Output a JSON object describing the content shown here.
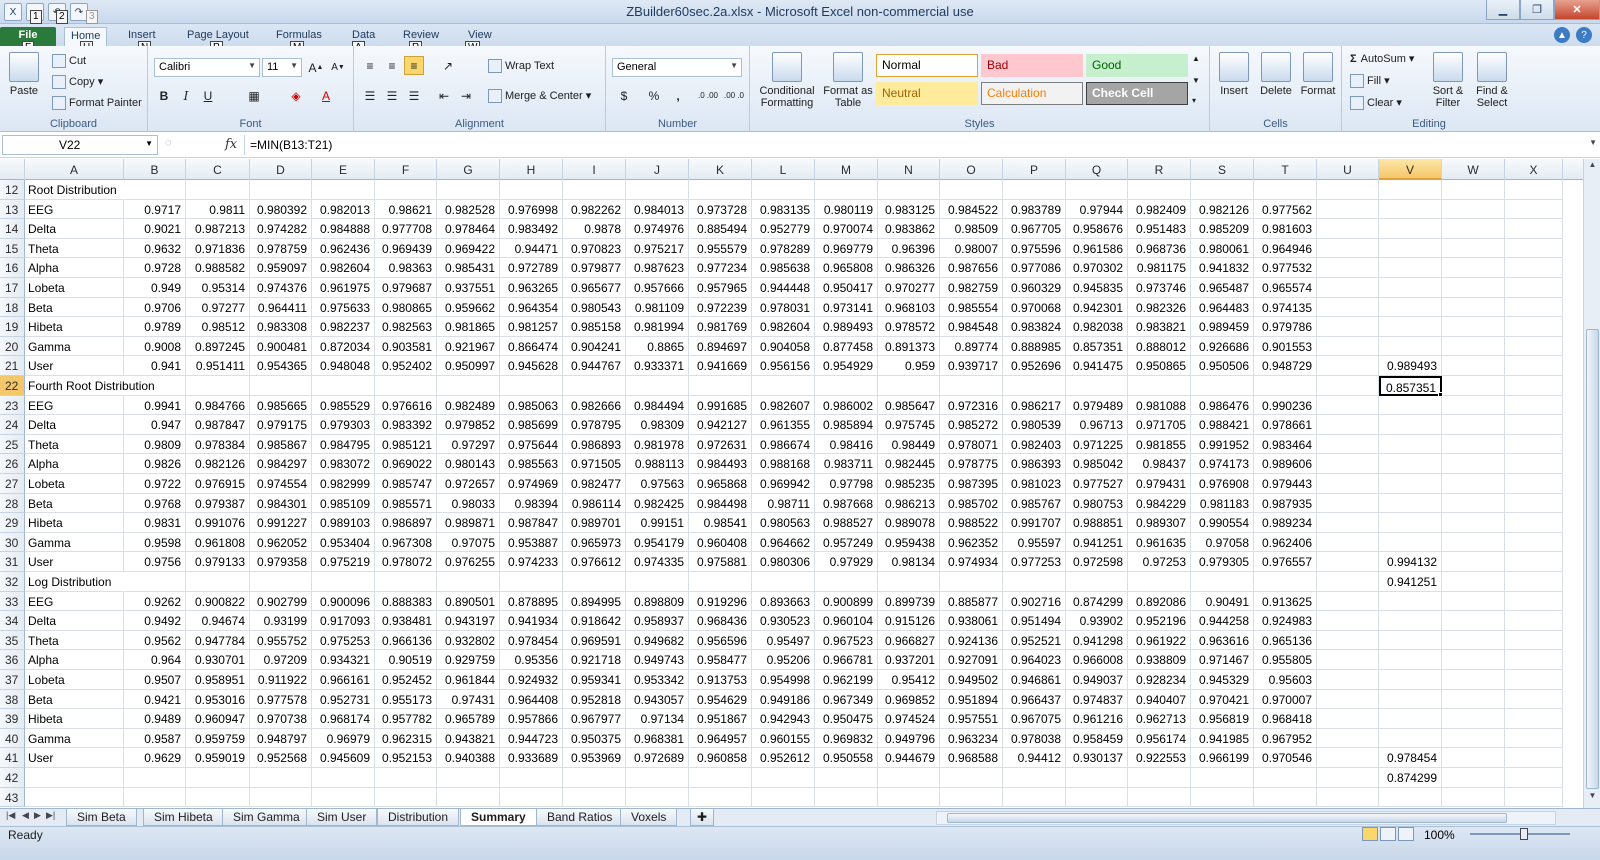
{
  "window": {
    "title": "ZBuilder60sec.2a.xlsx  -  Microsoft Excel non-commercial use"
  },
  "qat": {
    "keytips": [
      "1",
      "2",
      "3"
    ]
  },
  "ribbon_tabs": [
    {
      "label": "File",
      "keytip": "F"
    },
    {
      "label": "Home",
      "keytip": "H"
    },
    {
      "label": "Insert",
      "keytip": "N"
    },
    {
      "label": "Page Layout",
      "keytip": "P"
    },
    {
      "label": "Formulas",
      "keytip": "M"
    },
    {
      "label": "Data",
      "keytip": "A"
    },
    {
      "label": "Review",
      "keytip": "R"
    },
    {
      "label": "View",
      "keytip": "W"
    }
  ],
  "clipboard": {
    "paste": "Paste",
    "cut": "Cut",
    "copy": "Copy",
    "format_painter": "Format Painter",
    "label": "Clipboard"
  },
  "font": {
    "name": "Calibri",
    "size": "11",
    "label": "Font",
    "bold": "B",
    "italic": "I",
    "underline": "U"
  },
  "alignment": {
    "wrap": "Wrap Text",
    "merge": "Merge & Center",
    "label": "Alignment"
  },
  "number": {
    "format": "General",
    "label": "Number",
    "currency": "$",
    "percent": "%",
    "comma": ",",
    "inc": ".0 .00",
    "dec": ".00 .0"
  },
  "styles": {
    "conditional": "Conditional Formatting",
    "format_table": "Format as Table",
    "label": "Styles",
    "cells": [
      {
        "name": "Normal",
        "bg": "#ffffff",
        "fg": "#000000",
        "border": "#e2a233"
      },
      {
        "name": "Bad",
        "bg": "#ffc7ce",
        "fg": "#9c0006",
        "border": "#ffc7ce"
      },
      {
        "name": "Good",
        "bg": "#c6efce",
        "fg": "#006100",
        "border": "#c6efce"
      },
      {
        "name": "Neutral",
        "bg": "#ffeb9c",
        "fg": "#9c6500",
        "border": "#ffeb9c"
      },
      {
        "name": "Calculation",
        "bg": "#f2f2f2",
        "fg": "#fa7d00",
        "border": "#7f7f7f"
      },
      {
        "name": "Check Cell",
        "bg": "#a5a5a5",
        "fg": "#ffffff",
        "border": "#3f3f3f"
      }
    ]
  },
  "cells_group": {
    "insert": "Insert",
    "delete": "Delete",
    "format": "Format",
    "label": "Cells"
  },
  "editing": {
    "autosum": "AutoSum",
    "fill": "Fill",
    "clear": "Clear",
    "sort": "Sort & Filter",
    "find": "Find & Select",
    "label": "Editing"
  },
  "formula_bar": {
    "name_box": "V22",
    "fx": "fx",
    "formula": "=MIN(B13:T21)"
  },
  "columns": [
    "A",
    "B",
    "C",
    "D",
    "E",
    "F",
    "G",
    "H",
    "I",
    "J",
    "K",
    "L",
    "M",
    "N",
    "O",
    "P",
    "Q",
    "R",
    "S",
    "T",
    "U",
    "V",
    "W",
    "X"
  ],
  "active_column": "V",
  "active_row": 22,
  "rows": [
    {
      "n": 12,
      "a": "Root Distribution",
      "v": []
    },
    {
      "n": 13,
      "a": "EEG",
      "v": [
        "0.9717",
        "0.9811",
        "0.980392",
        "0.982013",
        "0.98621",
        "0.982528",
        "0.976998",
        "0.982262",
        "0.984013",
        "0.973728",
        "0.983135",
        "0.980119",
        "0.983125",
        "0.984522",
        "0.983789",
        "0.97944",
        "0.982409",
        "0.982126",
        "0.977562"
      ]
    },
    {
      "n": 14,
      "a": "Delta",
      "v": [
        "0.9021",
        "0.987213",
        "0.974282",
        "0.984888",
        "0.977708",
        "0.978464",
        "0.983492",
        "0.9878",
        "0.974976",
        "0.885494",
        "0.952779",
        "0.970074",
        "0.983862",
        "0.98509",
        "0.967705",
        "0.958676",
        "0.951483",
        "0.985209",
        "0.981603"
      ]
    },
    {
      "n": 15,
      "a": "Theta",
      "v": [
        "0.9632",
        "0.971836",
        "0.978759",
        "0.962436",
        "0.969439",
        "0.969422",
        "0.94471",
        "0.970823",
        "0.975217",
        "0.955579",
        "0.978289",
        "0.969779",
        "0.96396",
        "0.98007",
        "0.975596",
        "0.961586",
        "0.968736",
        "0.980061",
        "0.964946"
      ]
    },
    {
      "n": 16,
      "a": "Alpha",
      "v": [
        "0.9728",
        "0.988582",
        "0.959097",
        "0.982604",
        "0.98363",
        "0.985431",
        "0.972789",
        "0.979877",
        "0.987623",
        "0.977234",
        "0.985638",
        "0.965808",
        "0.986326",
        "0.987656",
        "0.977086",
        "0.970302",
        "0.981175",
        "0.941832",
        "0.977532"
      ]
    },
    {
      "n": 17,
      "a": "Lobeta",
      "v": [
        "0.949",
        "0.95314",
        "0.974376",
        "0.961975",
        "0.979687",
        "0.937551",
        "0.963265",
        "0.965677",
        "0.957666",
        "0.957965",
        "0.944448",
        "0.950417",
        "0.970277",
        "0.982759",
        "0.960329",
        "0.945835",
        "0.973746",
        "0.965487",
        "0.965574"
      ]
    },
    {
      "n": 18,
      "a": "Beta",
      "v": [
        "0.9706",
        "0.97277",
        "0.964411",
        "0.975633",
        "0.980865",
        "0.959662",
        "0.964354",
        "0.980543",
        "0.981109",
        "0.972239",
        "0.978031",
        "0.973141",
        "0.968103",
        "0.985554",
        "0.970068",
        "0.942301",
        "0.982326",
        "0.964483",
        "0.974135"
      ]
    },
    {
      "n": 19,
      "a": "Hibeta",
      "v": [
        "0.9789",
        "0.98512",
        "0.983308",
        "0.982237",
        "0.982563",
        "0.981865",
        "0.981257",
        "0.985158",
        "0.981994",
        "0.981769",
        "0.982604",
        "0.989493",
        "0.978572",
        "0.984548",
        "0.983824",
        "0.982038",
        "0.983821",
        "0.989459",
        "0.979786"
      ]
    },
    {
      "n": 20,
      "a": "Gamma",
      "v": [
        "0.9008",
        "0.897245",
        "0.900481",
        "0.872034",
        "0.903581",
        "0.921967",
        "0.866474",
        "0.904241",
        "0.8865",
        "0.894697",
        "0.904058",
        "0.877458",
        "0.891373",
        "0.89774",
        "0.888985",
        "0.857351",
        "0.888012",
        "0.926686",
        "0.901553"
      ]
    },
    {
      "n": 21,
      "a": "User",
      "v": [
        "0.941",
        "0.951411",
        "0.954365",
        "0.948048",
        "0.952402",
        "0.950997",
        "0.945628",
        "0.944767",
        "0.933371",
        "0.941669",
        "0.956156",
        "0.954929",
        "0.959",
        "0.939717",
        "0.952696",
        "0.941475",
        "0.950865",
        "0.950506",
        "0.948729"
      ],
      "vcol": "0.989493"
    },
    {
      "n": 22,
      "a": "Fourth Root Distribution",
      "v": [],
      "vcol": "0.857351"
    },
    {
      "n": 23,
      "a": "EEG",
      "v": [
        "0.9941",
        "0.984766",
        "0.985665",
        "0.985529",
        "0.976616",
        "0.982489",
        "0.985063",
        "0.982666",
        "0.984494",
        "0.991685",
        "0.982607",
        "0.986002",
        "0.985647",
        "0.972316",
        "0.986217",
        "0.979489",
        "0.981088",
        "0.986476",
        "0.990236"
      ]
    },
    {
      "n": 24,
      "a": "Delta",
      "v": [
        "0.947",
        "0.987847",
        "0.979175",
        "0.979303",
        "0.983392",
        "0.979852",
        "0.985699",
        "0.978795",
        "0.98309",
        "0.942127",
        "0.961355",
        "0.985894",
        "0.975745",
        "0.985272",
        "0.980539",
        "0.96713",
        "0.971705",
        "0.988421",
        "0.978661"
      ]
    },
    {
      "n": 25,
      "a": "Theta",
      "v": [
        "0.9809",
        "0.978384",
        "0.985867",
        "0.984795",
        "0.985121",
        "0.97297",
        "0.975644",
        "0.986893",
        "0.981978",
        "0.972631",
        "0.986674",
        "0.98416",
        "0.98449",
        "0.978071",
        "0.982403",
        "0.971225",
        "0.981855",
        "0.991952",
        "0.983464"
      ]
    },
    {
      "n": 26,
      "a": "Alpha",
      "v": [
        "0.9826",
        "0.982126",
        "0.984297",
        "0.983072",
        "0.969022",
        "0.980143",
        "0.985563",
        "0.971505",
        "0.988113",
        "0.984493",
        "0.988168",
        "0.983711",
        "0.982445",
        "0.978775",
        "0.986393",
        "0.985042",
        "0.98437",
        "0.974173",
        "0.989606"
      ]
    },
    {
      "n": 27,
      "a": "Lobeta",
      "v": [
        "0.9722",
        "0.976915",
        "0.974554",
        "0.982999",
        "0.985747",
        "0.972657",
        "0.974969",
        "0.982477",
        "0.97563",
        "0.965868",
        "0.969942",
        "0.97798",
        "0.985235",
        "0.987395",
        "0.981023",
        "0.977527",
        "0.979431",
        "0.976908",
        "0.979443"
      ]
    },
    {
      "n": 28,
      "a": "Beta",
      "v": [
        "0.9768",
        "0.979387",
        "0.984301",
        "0.985109",
        "0.985571",
        "0.98033",
        "0.98394",
        "0.986114",
        "0.982425",
        "0.984498",
        "0.98711",
        "0.987668",
        "0.986213",
        "0.985702",
        "0.985767",
        "0.980753",
        "0.984229",
        "0.981183",
        "0.987935"
      ]
    },
    {
      "n": 29,
      "a": "Hibeta",
      "v": [
        "0.9831",
        "0.991076",
        "0.991227",
        "0.989103",
        "0.986897",
        "0.989871",
        "0.987847",
        "0.989701",
        "0.99151",
        "0.98541",
        "0.980563",
        "0.988527",
        "0.989078",
        "0.988522",
        "0.991707",
        "0.988851",
        "0.989307",
        "0.990554",
        "0.989234"
      ]
    },
    {
      "n": 30,
      "a": "Gamma",
      "v": [
        "0.9598",
        "0.961808",
        "0.962052",
        "0.953404",
        "0.967308",
        "0.97075",
        "0.953887",
        "0.965973",
        "0.954179",
        "0.960408",
        "0.964662",
        "0.957249",
        "0.959438",
        "0.962352",
        "0.95597",
        "0.941251",
        "0.961635",
        "0.97058",
        "0.962406"
      ]
    },
    {
      "n": 31,
      "a": "User",
      "v": [
        "0.9756",
        "0.979133",
        "0.979358",
        "0.975219",
        "0.978072",
        "0.976255",
        "0.974233",
        "0.976612",
        "0.974335",
        "0.975881",
        "0.980306",
        "0.97929",
        "0.98134",
        "0.974934",
        "0.977253",
        "0.972598",
        "0.97253",
        "0.979305",
        "0.976557"
      ],
      "vcol": "0.994132"
    },
    {
      "n": 32,
      "a": "Log Distribution",
      "v": [],
      "vcol": "0.941251"
    },
    {
      "n": 33,
      "a": "EEG",
      "v": [
        "0.9262",
        "0.900822",
        "0.902799",
        "0.900096",
        "0.888383",
        "0.890501",
        "0.878895",
        "0.894995",
        "0.898809",
        "0.919296",
        "0.893663",
        "0.900899",
        "0.899739",
        "0.885877",
        "0.902716",
        "0.874299",
        "0.892086",
        "0.90491",
        "0.913625"
      ]
    },
    {
      "n": 34,
      "a": "Delta",
      "v": [
        "0.9492",
        "0.94674",
        "0.93199",
        "0.917093",
        "0.938481",
        "0.943197",
        "0.941934",
        "0.918642",
        "0.958937",
        "0.968436",
        "0.930523",
        "0.960104",
        "0.915126",
        "0.938061",
        "0.951494",
        "0.93902",
        "0.952196",
        "0.944258",
        "0.924983"
      ]
    },
    {
      "n": 35,
      "a": "Theta",
      "v": [
        "0.9562",
        "0.947784",
        "0.955752",
        "0.975253",
        "0.966136",
        "0.932802",
        "0.978454",
        "0.969591",
        "0.949682",
        "0.956596",
        "0.95497",
        "0.967523",
        "0.966827",
        "0.924136",
        "0.952521",
        "0.941298",
        "0.961922",
        "0.963616",
        "0.965136"
      ]
    },
    {
      "n": 36,
      "a": "Alpha",
      "v": [
        "0.964",
        "0.930701",
        "0.97209",
        "0.934321",
        "0.90519",
        "0.929759",
        "0.95356",
        "0.921718",
        "0.949743",
        "0.958477",
        "0.95206",
        "0.966781",
        "0.937201",
        "0.927091",
        "0.964023",
        "0.966008",
        "0.938809",
        "0.971467",
        "0.955805"
      ]
    },
    {
      "n": 37,
      "a": "Lobeta",
      "v": [
        "0.9507",
        "0.958951",
        "0.911922",
        "0.966161",
        "0.952452",
        "0.961844",
        "0.924932",
        "0.959341",
        "0.953342",
        "0.913753",
        "0.954998",
        "0.962199",
        "0.95412",
        "0.949502",
        "0.946861",
        "0.949037",
        "0.928234",
        "0.945329",
        "0.95603"
      ]
    },
    {
      "n": 38,
      "a": "Beta",
      "v": [
        "0.9421",
        "0.953016",
        "0.977578",
        "0.952731",
        "0.955173",
        "0.97431",
        "0.964408",
        "0.952818",
        "0.943057",
        "0.954629",
        "0.949186",
        "0.967349",
        "0.969852",
        "0.951894",
        "0.966437",
        "0.974837",
        "0.940407",
        "0.970421",
        "0.970007"
      ]
    },
    {
      "n": 39,
      "a": "Hibeta",
      "v": [
        "0.9489",
        "0.960947",
        "0.970738",
        "0.968174",
        "0.957782",
        "0.965789",
        "0.957866",
        "0.967977",
        "0.97134",
        "0.951867",
        "0.942943",
        "0.950475",
        "0.974524",
        "0.957551",
        "0.967075",
        "0.961216",
        "0.962713",
        "0.956819",
        "0.968418"
      ]
    },
    {
      "n": 40,
      "a": "Gamma",
      "v": [
        "0.9587",
        "0.959759",
        "0.948797",
        "0.96979",
        "0.962315",
        "0.943821",
        "0.944723",
        "0.950375",
        "0.968381",
        "0.964957",
        "0.960155",
        "0.969832",
        "0.949796",
        "0.963234",
        "0.978038",
        "0.958459",
        "0.956174",
        "0.941985",
        "0.967952"
      ]
    },
    {
      "n": 41,
      "a": "User",
      "v": [
        "0.9629",
        "0.959019",
        "0.952568",
        "0.945609",
        "0.952153",
        "0.940388",
        "0.933689",
        "0.953969",
        "0.972689",
        "0.960858",
        "0.952612",
        "0.950558",
        "0.944679",
        "0.968588",
        "0.94412",
        "0.930137",
        "0.922553",
        "0.966199",
        "0.970546"
      ],
      "vcol": "0.978454"
    },
    {
      "n": 42,
      "a": "",
      "v": [],
      "vcol": "0.874299"
    },
    {
      "n": 43,
      "a": "",
      "v": []
    }
  ],
  "sheet_tabs": [
    "Sim Beta",
    "Sim Hibeta",
    "Sim Gamma",
    "Sim User",
    "Distribution",
    "Summary",
    "Band Ratios",
    "Voxels"
  ],
  "active_sheet": "Summary",
  "status": {
    "ready": "Ready",
    "zoom": "100%"
  }
}
